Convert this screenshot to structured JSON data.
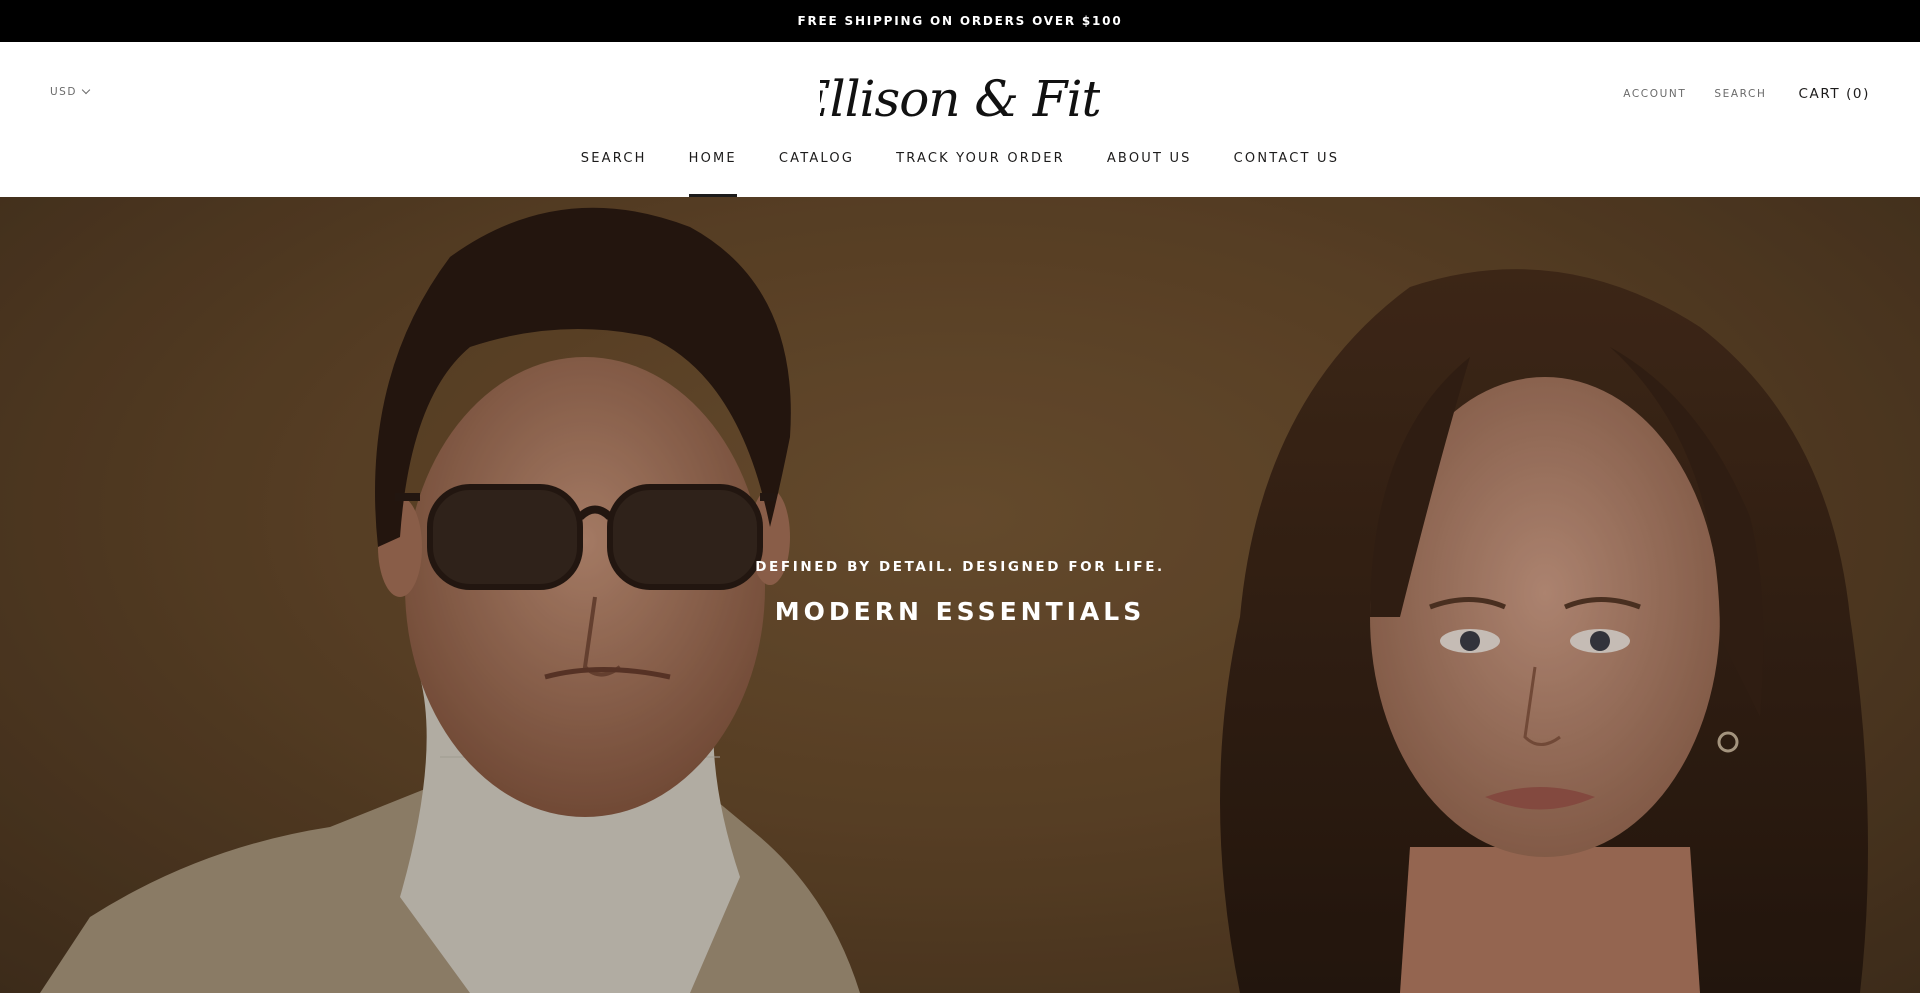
{
  "announcement": {
    "text": "FREE SHIPPING ON ORDERS OVER $100"
  },
  "header": {
    "currency": "USD",
    "logo_text": "Ellison & Fitz",
    "account_label": "ACCOUNT",
    "search_label": "SEARCH",
    "cart_label": "CART (0)"
  },
  "nav": {
    "items": [
      {
        "label": "SEARCH"
      },
      {
        "label": "HOME",
        "active": true
      },
      {
        "label": "CATALOG"
      },
      {
        "label": "TRACK YOUR ORDER"
      },
      {
        "label": "ABOUT US"
      },
      {
        "label": "CONTACT US"
      }
    ]
  },
  "hero": {
    "subtitle": "DEFINED BY DETAIL. DESIGNED FOR LIFE.",
    "title": "MODERN ESSENTIALS"
  },
  "colors": {
    "announcement_bg": "#000000",
    "hero_bg": "#6a4c2c",
    "text": "#1c1b1b"
  }
}
